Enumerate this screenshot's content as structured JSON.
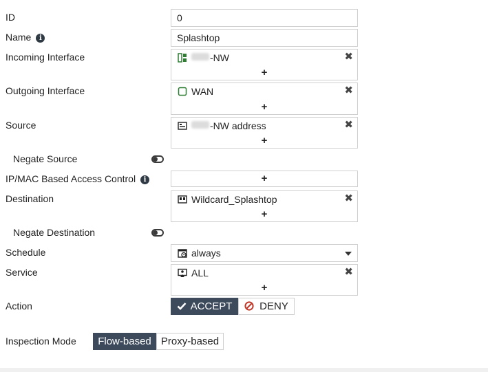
{
  "fields": {
    "id": {
      "label": "ID",
      "value": "0"
    },
    "name": {
      "label": "Name",
      "info_icon": "info-icon",
      "value": "Splashtop"
    },
    "incoming_interface": {
      "label": "Incoming Interface",
      "entry": "-NW",
      "icon": "port-icon",
      "add": "+",
      "remove": "✖"
    },
    "outgoing_interface": {
      "label": "Outgoing Interface",
      "entry": "WAN",
      "icon": "interface-square-icon",
      "add": "+",
      "remove": "✖"
    },
    "source": {
      "label": "Source",
      "entry": "-NW address",
      "icon": "address-icon",
      "add": "+",
      "remove": "✖"
    },
    "negate_source": {
      "label": "Negate Source",
      "enabled": false
    },
    "ip_mac_access": {
      "label": "IP/MAC Based Access Control",
      "info_icon": "info-icon",
      "add": "+"
    },
    "destination": {
      "label": "Destination",
      "entry": "Wildcard_Splashtop",
      "icon": "wildcard-address-icon",
      "add": "+",
      "remove": "✖"
    },
    "negate_destination": {
      "label": "Negate Destination",
      "enabled": false
    },
    "schedule": {
      "label": "Schedule",
      "value": "always",
      "icon": "schedule-icon"
    },
    "service": {
      "label": "Service",
      "entry": "ALL",
      "icon": "service-icon",
      "add": "+",
      "remove": "✖"
    },
    "action": {
      "label": "Action",
      "options": [
        "ACCEPT",
        "DENY"
      ],
      "selected": "ACCEPT"
    },
    "inspection_mode": {
      "label": "Inspection Mode",
      "options": [
        "Flow-based",
        "Proxy-based"
      ],
      "selected": "Flow-based"
    }
  },
  "colors": {
    "accent": "#3c4a5c",
    "deny": "#c0392b",
    "interface_green": "#2e7d32"
  }
}
